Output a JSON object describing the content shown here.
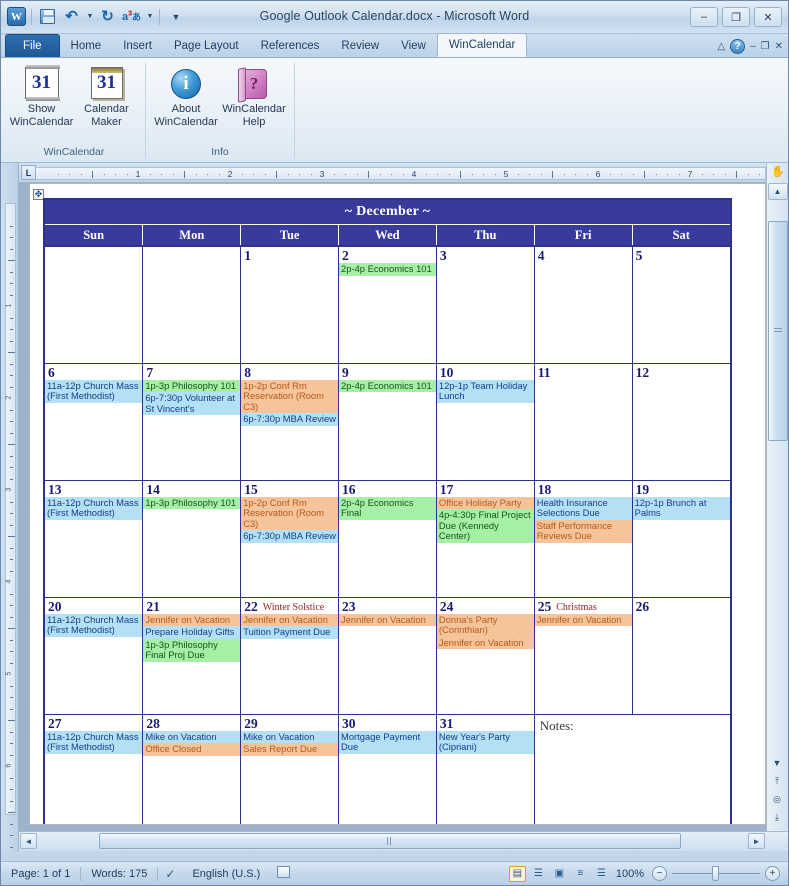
{
  "window": {
    "title": "Google Outlook Calendar.docx  -  Microsoft Word",
    "app_icon": "W",
    "minimize": "–",
    "maximize": "❐",
    "close": "✕"
  },
  "quick_access": [
    {
      "name": "save-icon",
      "label": "Save"
    },
    {
      "name": "undo-icon",
      "label": "↶"
    },
    {
      "name": "undo-dropdown-icon",
      "label": "▾"
    },
    {
      "name": "redo-icon",
      "label": "↻"
    },
    {
      "name": "language-icon",
      "label": "あ"
    },
    {
      "name": "language-dropdown-icon",
      "label": "▾"
    },
    {
      "name": "customize-qat-icon",
      "label": "▾"
    }
  ],
  "ribbon": {
    "tabs": [
      {
        "label": "File",
        "active": false,
        "is_file": true
      },
      {
        "label": "Home",
        "active": false
      },
      {
        "label": "Insert",
        "active": false
      },
      {
        "label": "Page Layout",
        "active": false
      },
      {
        "label": "References",
        "active": false
      },
      {
        "label": "Review",
        "active": false
      },
      {
        "label": "View",
        "active": false
      },
      {
        "label": "WinCalendar",
        "active": true
      }
    ],
    "right_controls": {
      "collapse_ribbon": "△",
      "help": "?",
      "min": "–",
      "restore": "❐",
      "close": "✕"
    },
    "groups": [
      {
        "name": "WinCalendar",
        "label": "WinCalendar",
        "buttons": [
          {
            "name": "show-wincalendar-button",
            "line1": "Show",
            "line2": "WinCalendar",
            "icon": "calendar-31-updown-icon",
            "icon_text": "31"
          },
          {
            "name": "calendar-maker-button",
            "line1": "Calendar",
            "line2": "Maker",
            "icon": "calendar-31-icon",
            "icon_text": "31"
          }
        ]
      },
      {
        "name": "Info",
        "label": "Info",
        "buttons": [
          {
            "name": "about-wincalendar-button",
            "line1": "About",
            "line2": "WinCalendar",
            "icon": "info-circle-icon",
            "icon_text": "i"
          },
          {
            "name": "wincalendar-help-button",
            "line1": "WinCalendar",
            "line2": "Help",
            "icon": "help-book-icon",
            "icon_text": "?"
          }
        ]
      }
    ]
  },
  "ruler": {
    "corner_label": "L",
    "horizontal_numbers": [
      "1",
      "2",
      "3",
      "4",
      "5",
      "6",
      "7"
    ],
    "vertical_numbers": [
      "1",
      "2",
      "3",
      "4",
      "5",
      "6"
    ]
  },
  "calendar": {
    "title": "~ December ~",
    "day_headers": [
      "Sun",
      "Mon",
      "Tue",
      "Wed",
      "Thu",
      "Fri",
      "Sat"
    ],
    "notes_label": "Notes:",
    "weeks": [
      [
        {
          "blank": true
        },
        {
          "blank": true
        },
        {
          "day": "1",
          "weekend": false,
          "events": []
        },
        {
          "day": "2",
          "weekend": false,
          "events": [
            {
              "text": "2p-4p Economics 101",
              "color": "green"
            }
          ]
        },
        {
          "day": "3",
          "weekend": false,
          "events": []
        },
        {
          "day": "4",
          "weekend": false,
          "events": []
        },
        {
          "day": "5",
          "weekend": true,
          "events": []
        }
      ],
      [
        {
          "day": "6",
          "weekend": true,
          "events": [
            {
              "text": "11a-12p Church Mass (First Methodist)",
              "color": "blue"
            }
          ]
        },
        {
          "day": "7",
          "weekend": false,
          "events": [
            {
              "text": "1p-3p Philosophy 101",
              "color": "green"
            },
            {
              "text": "6p-7:30p Volunteer at St Vincent's",
              "color": "blue"
            }
          ]
        },
        {
          "day": "8",
          "weekend": false,
          "events": [
            {
              "text": "1p-2p Conf Rm Reservation (Room C3)",
              "color": "orange"
            },
            {
              "text": "6p-7:30p MBA Review",
              "color": "blue"
            }
          ]
        },
        {
          "day": "9",
          "weekend": false,
          "events": [
            {
              "text": "2p-4p Economics 101",
              "color": "green"
            }
          ]
        },
        {
          "day": "10",
          "weekend": false,
          "events": [
            {
              "text": "12p-1p Team Holiday Lunch",
              "color": "blue"
            }
          ]
        },
        {
          "day": "11",
          "weekend": false,
          "events": []
        },
        {
          "day": "12",
          "weekend": true,
          "events": []
        }
      ],
      [
        {
          "day": "13",
          "weekend": true,
          "events": [
            {
              "text": "11a-12p Church Mass (First Methodist)",
              "color": "blue"
            }
          ]
        },
        {
          "day": "14",
          "weekend": false,
          "events": [
            {
              "text": "1p-3p Philosophy 101",
              "color": "green"
            }
          ]
        },
        {
          "day": "15",
          "weekend": false,
          "events": [
            {
              "text": "1p-2p Conf Rm Reservation (Room C3)",
              "color": "orange"
            },
            {
              "text": "6p-7:30p MBA Review",
              "color": "blue"
            }
          ]
        },
        {
          "day": "16",
          "weekend": false,
          "events": [
            {
              "text": "2p-4p Economics Final",
              "color": "green"
            }
          ]
        },
        {
          "day": "17",
          "weekend": false,
          "events": [
            {
              "text": "Office Holiday Party",
              "color": "orange"
            },
            {
              "text": "4p-4:30p Final Project Due (Kennedy Center)",
              "color": "green"
            }
          ]
        },
        {
          "day": "18",
          "weekend": false,
          "events": [
            {
              "text": "Health Insurance Selections Due",
              "color": "blue"
            },
            {
              "text": "Staff Performance Reviews Due",
              "color": "orange"
            }
          ]
        },
        {
          "day": "19",
          "weekend": true,
          "events": [
            {
              "text": "12p-1p Brunch at Palms",
              "color": "blue"
            }
          ]
        }
      ],
      [
        {
          "day": "20",
          "weekend": true,
          "events": [
            {
              "text": "11a-12p Church Mass (First Methodist)",
              "color": "blue"
            }
          ]
        },
        {
          "day": "21",
          "weekend": false,
          "events": [
            {
              "text": "Jennifer on Vacation",
              "color": "orange"
            },
            {
              "text": "Prepare Holiday Gifts",
              "color": "blue"
            },
            {
              "text": "1p-3p Philosophy Final Proj Due",
              "color": "green"
            }
          ]
        },
        {
          "day": "22",
          "holiday": "Winter Solstice",
          "weekend": false,
          "events": [
            {
              "text": "Jennifer on Vacation",
              "color": "orange"
            },
            {
              "text": "Tuition Payment Due",
              "color": "blue"
            }
          ]
        },
        {
          "day": "23",
          "weekend": false,
          "events": [
            {
              "text": "Jennifer on Vacation",
              "color": "orange"
            }
          ]
        },
        {
          "day": "24",
          "weekend": false,
          "events": [
            {
              "text": "Donna's Party (Corinthian)",
              "color": "orange"
            },
            {
              "text": "Jennifer on Vacation",
              "color": "orange"
            }
          ]
        },
        {
          "day": "25",
          "holiday": "Christmas",
          "weekend": false,
          "events": [
            {
              "text": "Jennifer on Vacation",
              "color": "orange"
            }
          ]
        },
        {
          "day": "26",
          "weekend": true,
          "events": []
        }
      ],
      [
        {
          "day": "27",
          "weekend": true,
          "events": [
            {
              "text": "11a-12p Church Mass (First Methodist)",
              "color": "blue"
            }
          ]
        },
        {
          "day": "28",
          "weekend": false,
          "events": [
            {
              "text": "Mike on Vacation",
              "color": "blue"
            },
            {
              "text": "Office Closed",
              "color": "orange"
            }
          ]
        },
        {
          "day": "29",
          "weekend": false,
          "events": [
            {
              "text": "Mike on Vacation",
              "color": "blue"
            },
            {
              "text": "Sales Report Due",
              "color": "orange"
            }
          ]
        },
        {
          "day": "30",
          "weekend": false,
          "events": [
            {
              "text": "Mortgage Payment Due",
              "color": "blue"
            }
          ]
        },
        {
          "day": "31",
          "weekend": false,
          "events": [
            {
              "text": "New Year's Party (Cipriani)",
              "color": "blue"
            }
          ]
        },
        {
          "notes": true
        }
      ]
    ]
  },
  "statusbar": {
    "page": "Page: 1 of 1",
    "words": "Words: 175",
    "proofing_icon": "spell-check-icon",
    "language": "English (U.S.)",
    "macro_icon": "macro-record-icon",
    "view_buttons": [
      {
        "name": "view-print-layout",
        "glyph": "▤",
        "selected": true
      },
      {
        "name": "view-full-screen-reading",
        "glyph": "☰",
        "selected": false
      },
      {
        "name": "view-web-layout",
        "glyph": "▣",
        "selected": false
      },
      {
        "name": "view-outline",
        "glyph": "≡",
        "selected": false
      },
      {
        "name": "view-draft",
        "glyph": "☰",
        "selected": false
      }
    ],
    "zoom": "100%",
    "zoom_out": "−",
    "zoom_in": "+"
  },
  "scroll": {
    "up_arrow": "▲",
    "down_arrow": "▼",
    "left_arrow": "◄",
    "right_arrow": "►",
    "prev_page": "⤒",
    "select_object": "◎",
    "next_page": "⤓",
    "hand_icon": "✋"
  },
  "colors": {
    "calendar_header": "#383a9c",
    "calendar_border": "#2f3191",
    "weekend_bg": "#fbfbe2",
    "blank_bg": "#bebebe",
    "event_blue": "#b3e0f5",
    "event_green": "#a6f0a6",
    "event_orange": "#f5c49a",
    "holiday_text": "#8b2525",
    "daynum_text": "#191970"
  }
}
